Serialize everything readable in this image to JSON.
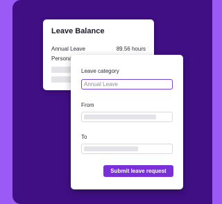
{
  "balance": {
    "title": "Leave Balance",
    "rows": [
      {
        "label": "Annual Leave",
        "value": "89.56 hours"
      },
      {
        "label": "Persona",
        "value": ""
      }
    ]
  },
  "form": {
    "category_label": "Leave category",
    "category_value": "Annual Leave",
    "from_label": "From",
    "to_label": "To",
    "submit_label": "Submit leave request"
  },
  "colors": {
    "background": "#9b59f5",
    "panel": "#3f0f83",
    "accent": "#7a2fd8"
  }
}
